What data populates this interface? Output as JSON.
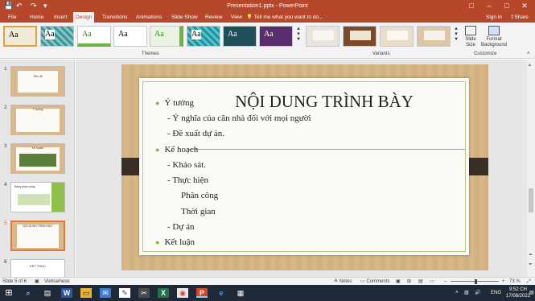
{
  "window": {
    "title": "Presentation1.pptx - PowerPoint",
    "user_btn": "□"
  },
  "quickaccess": {
    "save": "💾",
    "undo": "↶",
    "redo": "↷",
    "custom": "▾"
  },
  "controls": {
    "restore": "⧉",
    "minimize": "–",
    "maximize": "□",
    "close": "✕"
  },
  "tabs": [
    "File",
    "Home",
    "Insert",
    "Design",
    "Transitions",
    "Animations",
    "Slide Show",
    "Review",
    "View"
  ],
  "tell_me": "Tell me what you want to do...",
  "account": {
    "signin": "Sign in",
    "share": "Share"
  },
  "ribbon": {
    "themes_label": "Themes",
    "variants_label": "Variants",
    "customize_label": "Customize",
    "theme_text": "Aa",
    "slide_size": "Slide Size",
    "format_bg": "Format Background"
  },
  "slides": [
    {
      "num": "1",
      "title": "Tiêu đề"
    },
    {
      "num": "2",
      "title": "Ý tưởng"
    },
    {
      "num": "3",
      "title": "Kế hoạch"
    },
    {
      "num": "4",
      "title": "Bảng phân công"
    },
    {
      "num": "5",
      "title": "NỘI DUNG TRÌNH BÀY"
    },
    {
      "num": "6",
      "title": "KẾT THÚC"
    }
  ],
  "slide": {
    "title": "NỘI DUNG TRÌNH BÀY",
    "bullets": [
      {
        "text": "Ý tưởng",
        "level": 0
      },
      {
        "text": "- Ý nghĩa của căn nhà đối với mọi người",
        "level": 1
      },
      {
        "text": "- Đề xuất dự án.",
        "level": 1
      },
      {
        "text": "Kế hoạch",
        "level": 0
      },
      {
        "text": "- Khảo sát.",
        "level": 1
      },
      {
        "text": "- Thực hiện",
        "level": 1
      },
      {
        "text": "Phân công",
        "level": 2
      },
      {
        "text": "Thời gian",
        "level": 2
      },
      {
        "text": "- Dự án",
        "level": 1
      },
      {
        "text": "Kết luận",
        "level": 0
      }
    ]
  },
  "status": {
    "slide_info": "Slide 5 of 6",
    "language": "Vietnamese",
    "notes": "Notes",
    "comments": "Comments",
    "zoom": "73 %",
    "zoom_pct": 73
  },
  "taskbar": {
    "start": "⊞",
    "search": "⌕",
    "task_view": "▤",
    "word": "W",
    "excel": "X",
    "powerpoint": "P",
    "edge": "e",
    "calc": "▦",
    "lang": "ENG",
    "time": "9:52 CH",
    "date": "17/08/2022"
  },
  "colors": {
    "accent": "#b7472a",
    "bullet": "#8fb032",
    "wood": "#d9b98a"
  }
}
